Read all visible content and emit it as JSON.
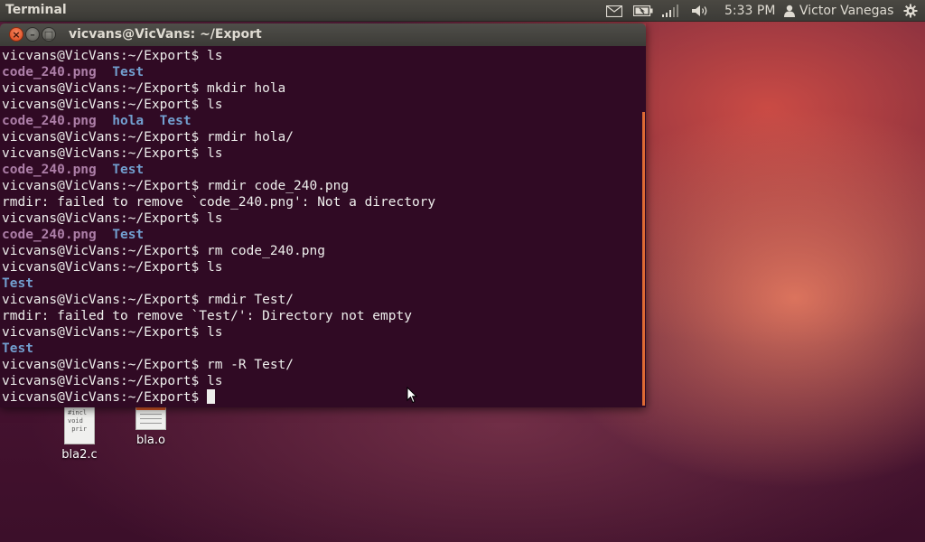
{
  "top_panel": {
    "app_title": "Terminal",
    "clock": "5:33 PM",
    "user_name": "Victor Vanegas",
    "indicators": [
      "mail-icon",
      "battery-icon",
      "network-signal-icon",
      "volume-icon",
      "user-icon",
      "gear-icon"
    ]
  },
  "window": {
    "title": "vicvans@VicVans: ~/Export",
    "buttons": {
      "close": "×",
      "minimize": "–",
      "maximize": "□"
    }
  },
  "terminal": {
    "prompt": "vicvans@VicVans:~/Export$",
    "lines": [
      {
        "t": "prompt",
        "cmd": " ls"
      },
      {
        "t": "ls",
        "items": [
          {
            "name": "code_240.png",
            "kind": "file"
          },
          {
            "name": "Test",
            "kind": "dir"
          }
        ]
      },
      {
        "t": "prompt",
        "cmd": " mkdir hola"
      },
      {
        "t": "prompt",
        "cmd": " ls"
      },
      {
        "t": "ls",
        "items": [
          {
            "name": "code_240.png",
            "kind": "file"
          },
          {
            "name": "hola",
            "kind": "dir"
          },
          {
            "name": "Test",
            "kind": "dir"
          }
        ]
      },
      {
        "t": "prompt",
        "cmd": " rmdir hola/"
      },
      {
        "t": "prompt",
        "cmd": " ls"
      },
      {
        "t": "ls",
        "items": [
          {
            "name": "code_240.png",
            "kind": "file"
          },
          {
            "name": "Test",
            "kind": "dir"
          }
        ]
      },
      {
        "t": "prompt",
        "cmd": " rmdir code_240.png"
      },
      {
        "t": "out",
        "text": "rmdir: failed to remove `code_240.png': Not a directory"
      },
      {
        "t": "prompt",
        "cmd": " ls"
      },
      {
        "t": "ls",
        "items": [
          {
            "name": "code_240.png",
            "kind": "file"
          },
          {
            "name": "Test",
            "kind": "dir"
          }
        ]
      },
      {
        "t": "prompt",
        "cmd": " rm code_240.png"
      },
      {
        "t": "prompt",
        "cmd": " ls"
      },
      {
        "t": "ls",
        "items": [
          {
            "name": "Test",
            "kind": "dir"
          }
        ]
      },
      {
        "t": "prompt",
        "cmd": " rmdir Test/"
      },
      {
        "t": "out",
        "text": "rmdir: failed to remove `Test/': Directory not empty"
      },
      {
        "t": "prompt",
        "cmd": " ls"
      },
      {
        "t": "ls",
        "items": [
          {
            "name": "Test",
            "kind": "dir"
          }
        ]
      },
      {
        "t": "prompt",
        "cmd": " rm -R Test/"
      },
      {
        "t": "prompt",
        "cmd": " ls"
      },
      {
        "t": "prompt",
        "cmd": " ",
        "cursor": true
      }
    ],
    "colors": {
      "background": "#300a24",
      "text": "#eeeeec",
      "file": "#ad7fa8",
      "dir": "#729fcf",
      "scrollbar": "#dd6a34"
    }
  },
  "desktop": {
    "icons": [
      {
        "label": "bla2.c",
        "preview": "#incl\nvoid\n prir",
        "icon": "c-source-file-icon"
      },
      {
        "label": "bla.o",
        "icon": "object-file-icon"
      }
    ]
  }
}
